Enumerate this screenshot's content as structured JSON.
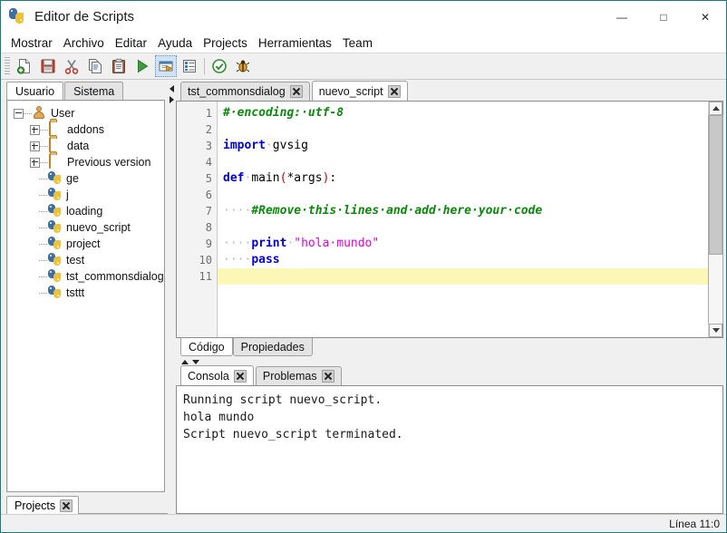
{
  "window": {
    "title": "Editor de Scripts",
    "icon": "python-icon",
    "controls": {
      "minimize": "—",
      "maximize": "□",
      "close": "✕"
    }
  },
  "menubar": {
    "items": [
      {
        "label": "Mostrar"
      },
      {
        "label": "Archivo"
      },
      {
        "label": "Editar"
      },
      {
        "label": "Ayuda"
      },
      {
        "label": "Projects"
      },
      {
        "label": "Herramientas"
      },
      {
        "label": "Team"
      }
    ]
  },
  "toolbar": {
    "buttons": [
      {
        "name": "new-script-icon",
        "selected": false
      },
      {
        "name": "save-icon",
        "selected": false
      },
      {
        "name": "cut-icon",
        "selected": false
      },
      {
        "name": "copy-icon",
        "selected": false
      },
      {
        "name": "paste-icon",
        "selected": false
      },
      {
        "name": "run-icon",
        "selected": false
      },
      {
        "name": "run-with-console-icon",
        "selected": true
      },
      {
        "name": "properties-icon",
        "selected": false
      },
      {
        "name": "check-syntax-icon",
        "selected": false
      },
      {
        "name": "debug-bug-icon",
        "selected": false
      }
    ]
  },
  "sidebar": {
    "tabs": [
      {
        "label": "Usuario",
        "active": true
      },
      {
        "label": "Sistema",
        "active": false
      }
    ],
    "tree": [
      {
        "label": "User",
        "icon": "user-icon",
        "depth": 0,
        "toggle": "minus"
      },
      {
        "label": "addons",
        "icon": "folder-icon",
        "depth": 1,
        "toggle": "plus"
      },
      {
        "label": "data",
        "icon": "folder-icon",
        "depth": 1,
        "toggle": "plus"
      },
      {
        "label": "Previous version",
        "icon": "folder-icon",
        "depth": 1,
        "toggle": "plus"
      },
      {
        "label": "ge",
        "icon": "python-file-icon",
        "depth": 1,
        "toggle": "none"
      },
      {
        "label": "j",
        "icon": "python-file-icon",
        "depth": 1,
        "toggle": "none"
      },
      {
        "label": "loading",
        "icon": "python-file-icon",
        "depth": 1,
        "toggle": "none"
      },
      {
        "label": "nuevo_script",
        "icon": "python-file-icon",
        "depth": 1,
        "toggle": "none"
      },
      {
        "label": "project",
        "icon": "python-file-icon",
        "depth": 1,
        "toggle": "none"
      },
      {
        "label": "test",
        "icon": "python-file-icon",
        "depth": 1,
        "toggle": "none"
      },
      {
        "label": "tst_commonsdialog",
        "icon": "python-file-icon",
        "depth": 1,
        "toggle": "none"
      },
      {
        "label": "tsttt",
        "icon": "python-file-icon",
        "depth": 1,
        "toggle": "none"
      }
    ],
    "bottom_tab": {
      "label": "Projects",
      "close": "✖"
    }
  },
  "editor": {
    "tabs": [
      {
        "label": "tst_commonsdialog",
        "active": false,
        "close": "✖"
      },
      {
        "label": "nuevo_script",
        "active": true,
        "close": "✖"
      }
    ],
    "line_numbers": [
      "1",
      "2",
      "3",
      "4",
      "5",
      "6",
      "7",
      "8",
      "9",
      "10",
      "11"
    ],
    "highlighted_line": 11,
    "lines": [
      {
        "n": 1,
        "tokens": [
          {
            "t": "# encoding: utf-8",
            "c": "cm"
          }
        ]
      },
      {
        "n": 2,
        "tokens": []
      },
      {
        "n": 3,
        "tokens": [
          {
            "t": "import",
            "c": "kw"
          },
          {
            "t": " ",
            "c": "ws"
          },
          {
            "t": "gvsig",
            "c": "id"
          }
        ]
      },
      {
        "n": 4,
        "tokens": []
      },
      {
        "n": 5,
        "tokens": [
          {
            "t": "def",
            "c": "kw"
          },
          {
            "t": " ",
            "c": "ws"
          },
          {
            "t": "main",
            "c": "id"
          },
          {
            "t": "(",
            "c": "pn"
          },
          {
            "t": "*args",
            "c": "id"
          },
          {
            "t": ")",
            "c": "pn"
          },
          {
            "t": ":",
            "c": "id"
          }
        ]
      },
      {
        "n": 6,
        "tokens": []
      },
      {
        "n": 7,
        "tokens": [
          {
            "t": "    ",
            "c": "ws"
          },
          {
            "t": "#Remove this lines and add here your code",
            "c": "cm"
          }
        ]
      },
      {
        "n": 8,
        "tokens": []
      },
      {
        "n": 9,
        "tokens": [
          {
            "t": "    ",
            "c": "ws"
          },
          {
            "t": "print",
            "c": "kw"
          },
          {
            "t": " ",
            "c": "ws"
          },
          {
            "t": "\"hola mundo\"",
            "c": "st"
          }
        ]
      },
      {
        "n": 10,
        "tokens": [
          {
            "t": "    ",
            "c": "ws"
          },
          {
            "t": "pass",
            "c": "kw"
          }
        ]
      },
      {
        "n": 11,
        "tokens": []
      }
    ],
    "bottom_tabs": [
      {
        "label": "Código",
        "active": true
      },
      {
        "label": "Propiedades",
        "active": false
      }
    ]
  },
  "console": {
    "tabs": [
      {
        "label": "Consola",
        "active": true,
        "close": "✖"
      },
      {
        "label": "Problemas",
        "active": false,
        "close": "✖"
      }
    ],
    "output": [
      "Running script nuevo_script.",
      "hola mundo",
      "Script nuevo_script terminated."
    ]
  },
  "statusbar": {
    "text": "Línea 11:0"
  },
  "colors": {
    "accent_border": "#1a7a78",
    "keyword": "#0000e0",
    "comment": "#0a8a0a",
    "string": "#e300e3",
    "paren": "#d40000",
    "highlight_line": "#fcf7b6"
  }
}
